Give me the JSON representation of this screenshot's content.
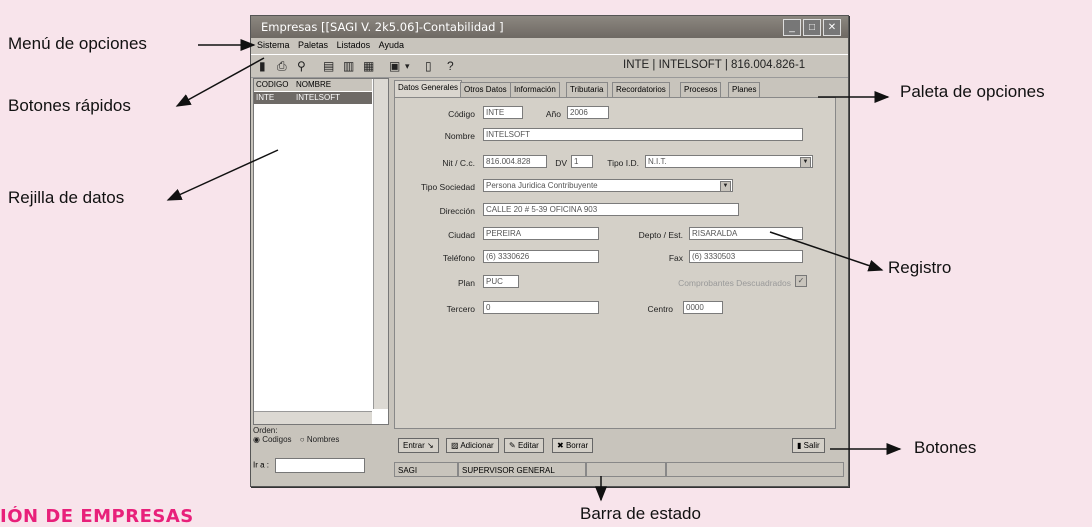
{
  "callouts": {
    "menu": "Menú de opciones",
    "botones_rapidos": "Botones rápidos",
    "rejilla": "Rejilla de datos",
    "paleta": "Paleta de opciones",
    "registro": "Registro",
    "botones": "Botones",
    "barra_estado": "Barra de estado"
  },
  "heading": "IÓN DE EMPRESAS",
  "window": {
    "title": "Empresas   [[SAGI V. 2k5.06]-Contabilidad ]",
    "menu": [
      "Sistema",
      "Paletas",
      "Listados",
      "Ayuda"
    ],
    "toolbar_info": "INTE  |  INTELSOFT  |  816.004.826-1"
  },
  "grid": {
    "headers": [
      "CODIGO",
      "NOMBRE"
    ],
    "rows": [
      {
        "codigo": "INTE",
        "nombre": "INTELSOFT"
      }
    ],
    "orden_label": "Orden:",
    "orden_opt1": "Codigos",
    "orden_opt2": "Nombres",
    "ira_label": "Ir a :"
  },
  "tabs": [
    "Datos Generales",
    "Otros Datos",
    "Información",
    "Tributaria",
    "Recordatorios",
    "Procesos",
    "Planes"
  ],
  "form": {
    "codigo_label": "Código",
    "codigo": "INTE",
    "anio_label": "Año",
    "anio": "2006",
    "nombre_label": "Nombre",
    "nombre": "INTELSOFT",
    "nit_label": "Nit / C.c.",
    "nit": "816.004.828",
    "dv_label": "DV",
    "dv": "1",
    "tipoid_label": "Tipo I.D.",
    "tipoid": "N.I.T.",
    "tiposoc_label": "Tipo Sociedad",
    "tiposoc": "Persona Juridica Contribuyente",
    "direccion_label": "Dirección",
    "direccion": "CALLE 20 # 5-39 OFICINA 903",
    "ciudad_label": "Ciudad",
    "ciudad": "PEREIRA",
    "depto_label": "Depto / Est.",
    "depto": "RISARALDA",
    "telefono_label": "Teléfono",
    "telefono": "(6) 3330626",
    "fax_label": "Fax",
    "fax": "(6) 3330503",
    "plan_label": "Plan",
    "plan": "PUC",
    "comprobantes_label": "Comprobantes Descuadrados",
    "tercero_label": "Tercero",
    "tercero": "0",
    "centro_label": "Centro",
    "centro": "0000"
  },
  "buttons": {
    "entrar": "Entrar",
    "adicionar": "Adicionar",
    "editar": "Editar",
    "borrar": "Borrar",
    "salir": "Salir"
  },
  "status": {
    "app": "SAGI",
    "user": "SUPERVISOR GENERAL"
  }
}
